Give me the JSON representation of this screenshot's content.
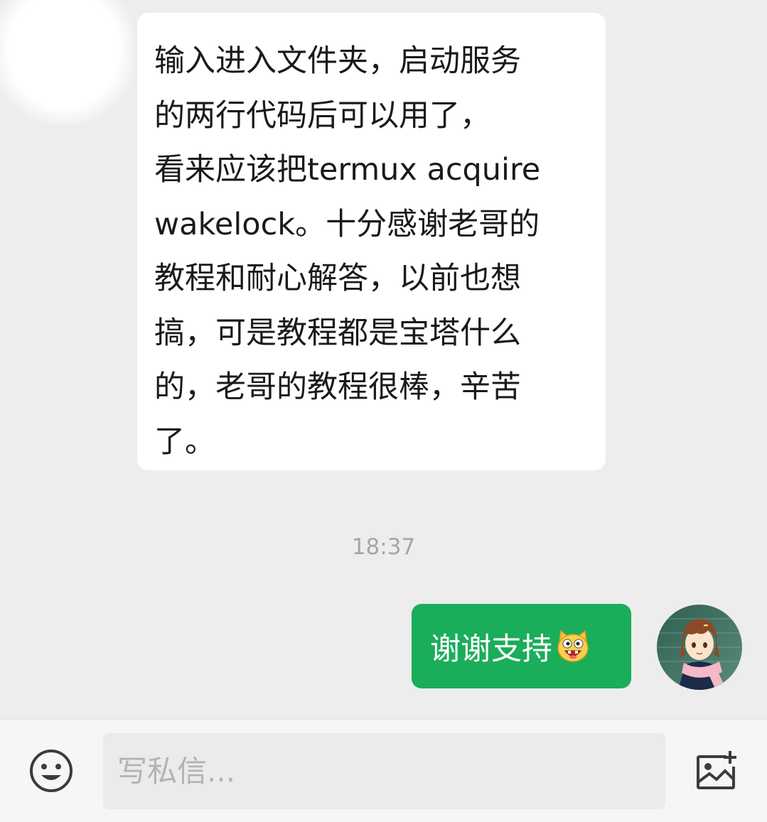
{
  "conversation": {
    "incoming_message": "输入进入文件夹，启动服务\n的两行代码后可以用了，\n看来应该把termux acquire\nwakelock。十分感谢老哥的\n教程和耐心解答，以前也想\n搞，可是教程都是宝塔什么\n的，老哥的教程很棒，辛苦\n了。",
    "timestamp": "18:37",
    "outgoing_message": "谢谢支持",
    "outgoing_emoji": "grinning-cat-emoji"
  },
  "composer": {
    "placeholder": "写私信...",
    "emoji_button_icon": "smiley-face-icon",
    "image_button_icon": "add-image-icon"
  },
  "colors": {
    "background": "#ededed",
    "incoming_bubble": "#ffffff",
    "outgoing_bubble": "#1aad5a",
    "timestamp_text": "#a6a6a6"
  }
}
